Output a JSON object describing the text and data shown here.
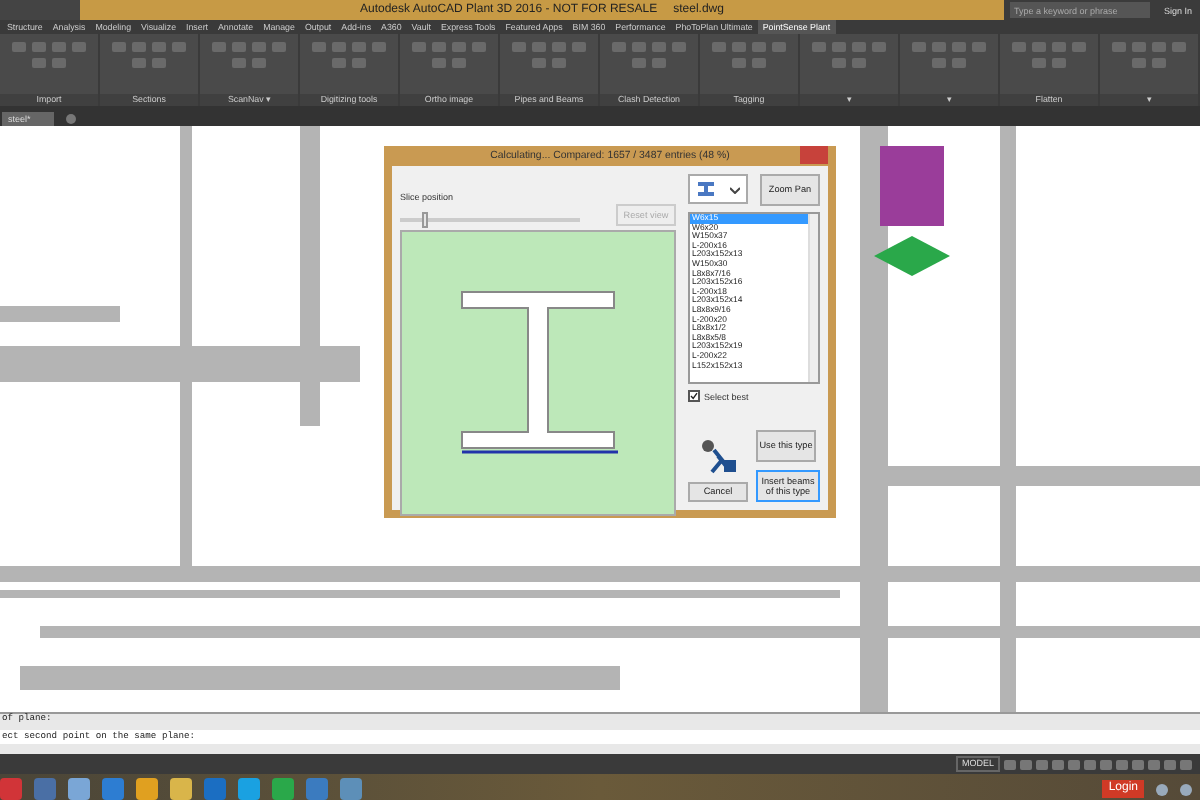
{
  "window": {
    "title": "Autodesk AutoCAD Plant 3D 2016 - NOT FOR RESALE",
    "file": "steel.dwg",
    "search": {
      "placeholder": "Type a keyword or phrase"
    },
    "sign_in": "Sign In"
  },
  "ribbon": {
    "tabs": [
      {
        "label": "Structure",
        "selected": false
      },
      {
        "label": "Analysis",
        "selected": false
      },
      {
        "label": "Modeling",
        "selected": false
      },
      {
        "label": "Visualize",
        "selected": false
      },
      {
        "label": "Insert",
        "selected": false
      },
      {
        "label": "Annotate",
        "selected": false
      },
      {
        "label": "Manage",
        "selected": false
      },
      {
        "label": "Output",
        "selected": false
      },
      {
        "label": "Add-ins",
        "selected": false
      },
      {
        "label": "A360",
        "selected": false
      },
      {
        "label": "Vault",
        "selected": false
      },
      {
        "label": "Express Tools",
        "selected": false
      },
      {
        "label": "Featured Apps",
        "selected": false
      },
      {
        "label": "BIM 360",
        "selected": false
      },
      {
        "label": "Performance",
        "selected": false
      },
      {
        "label": "PhoToPlan Ultimate",
        "selected": false
      },
      {
        "label": "PointSense Plant",
        "selected": true
      }
    ],
    "panels": [
      {
        "label": "Import"
      },
      {
        "label": "Sections"
      },
      {
        "label": "ScanNav ▾"
      },
      {
        "label": "Digitizing tools"
      },
      {
        "label": "Ortho image"
      },
      {
        "label": "Pipes and Beams"
      },
      {
        "label": "Clash Detection"
      },
      {
        "label": "Tagging"
      },
      {
        "label": "▾"
      },
      {
        "label": "▾"
      },
      {
        "label": "Flatten"
      },
      {
        "label": "▾"
      }
    ]
  },
  "document_tabs": [
    {
      "label": "steel*",
      "selected": true
    }
  ],
  "dialog": {
    "title": "Calculating... Compared: 1657 / 3487 entries (48 %)",
    "slice_label": "Slice position",
    "slider": {
      "level": 0.12
    },
    "reset_button": {
      "label": "Reset view",
      "disabled": true
    },
    "zoom_button": "Zoom Pan",
    "sections": [
      {
        "label": "W6x15",
        "selected": true
      },
      {
        "label": "W6x20",
        "selected": false
      },
      {
        "label": "W150x37",
        "selected": false
      },
      {
        "label": "L-200x16",
        "selected": false
      },
      {
        "label": "L203x152x13",
        "selected": false
      },
      {
        "label": "W150x30",
        "selected": false
      },
      {
        "label": "L8x8x7/16",
        "selected": false
      },
      {
        "label": "L203x152x16",
        "selected": false
      },
      {
        "label": "L-200x18",
        "selected": false
      },
      {
        "label": "L203x152x14",
        "selected": false
      },
      {
        "label": "L8x8x9/16",
        "selected": false
      },
      {
        "label": "L-200x20",
        "selected": false
      },
      {
        "label": "L8x8x1/2",
        "selected": false
      },
      {
        "label": "L8x8x5/8",
        "selected": false
      },
      {
        "label": "L203x152x19",
        "selected": false
      },
      {
        "label": "L-200x22",
        "selected": false
      },
      {
        "label": "L152x152x13",
        "selected": false
      }
    ],
    "select_best": {
      "label": "Select best",
      "checked": true
    },
    "use_button": "Use this type",
    "cancel_button": "Cancel",
    "insert_button": "Insert beams of this type"
  },
  "command_history": [
    "of plane:",
    "ect second point on the same plane:"
  ],
  "status_bar": {
    "mode": "MODEL"
  },
  "taskbar": {
    "login": "Login"
  }
}
